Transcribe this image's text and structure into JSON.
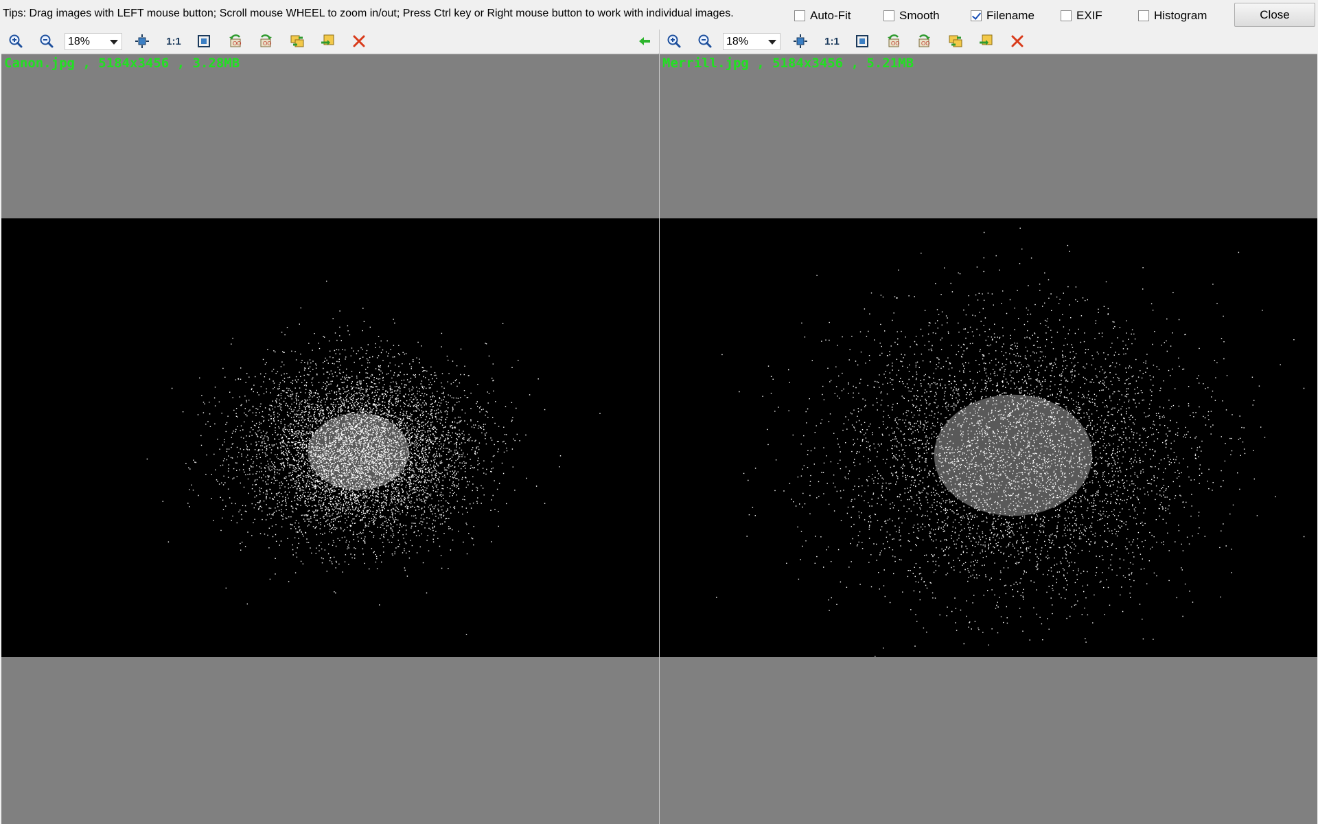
{
  "tips": "Tips: Drag images with LEFT mouse button; Scroll mouse WHEEL to zoom in/out; Press Ctrl key or Right mouse button to work with individual images.",
  "options": [
    {
      "label": "Auto-Fit",
      "checked": false
    },
    {
      "label": "Smooth",
      "checked": false
    },
    {
      "label": "Filename",
      "checked": true
    },
    {
      "label": "EXIF",
      "checked": false
    },
    {
      "label": "Histogram",
      "checked": false
    }
  ],
  "close_label": "Close",
  "panes": [
    {
      "zoom": "18%",
      "one_to_one": "1:1",
      "caption": "Canon.jpg , 5184x3456 , 3.28MB",
      "toolbar_icons": [
        "zoom-in-icon",
        "zoom-out-icon",
        "fit-icon",
        "actual-size-icon",
        "fullscreen-icon",
        "rotate-left-icon",
        "rotate-right-icon",
        "sync-icon",
        "swap-icon",
        "close-icon",
        "arrow-left-icon"
      ]
    },
    {
      "zoom": "18%",
      "one_to_one": "1:1",
      "caption": "Merrill.jpg , 5184x3456 , 5.21MB",
      "toolbar_icons": [
        "zoom-in-icon",
        "zoom-out-icon",
        "fit-icon",
        "actual-size-icon",
        "fullscreen-icon",
        "rotate-left-icon",
        "rotate-right-icon",
        "sync-icon",
        "swap-icon",
        "close-icon"
      ]
    }
  ],
  "colors": {
    "caption": "#22e022",
    "viewer_bg": "#808080",
    "image_bg": "#000000",
    "close_icon": "#d93a1a",
    "arrow_icon": "#2db52d"
  }
}
